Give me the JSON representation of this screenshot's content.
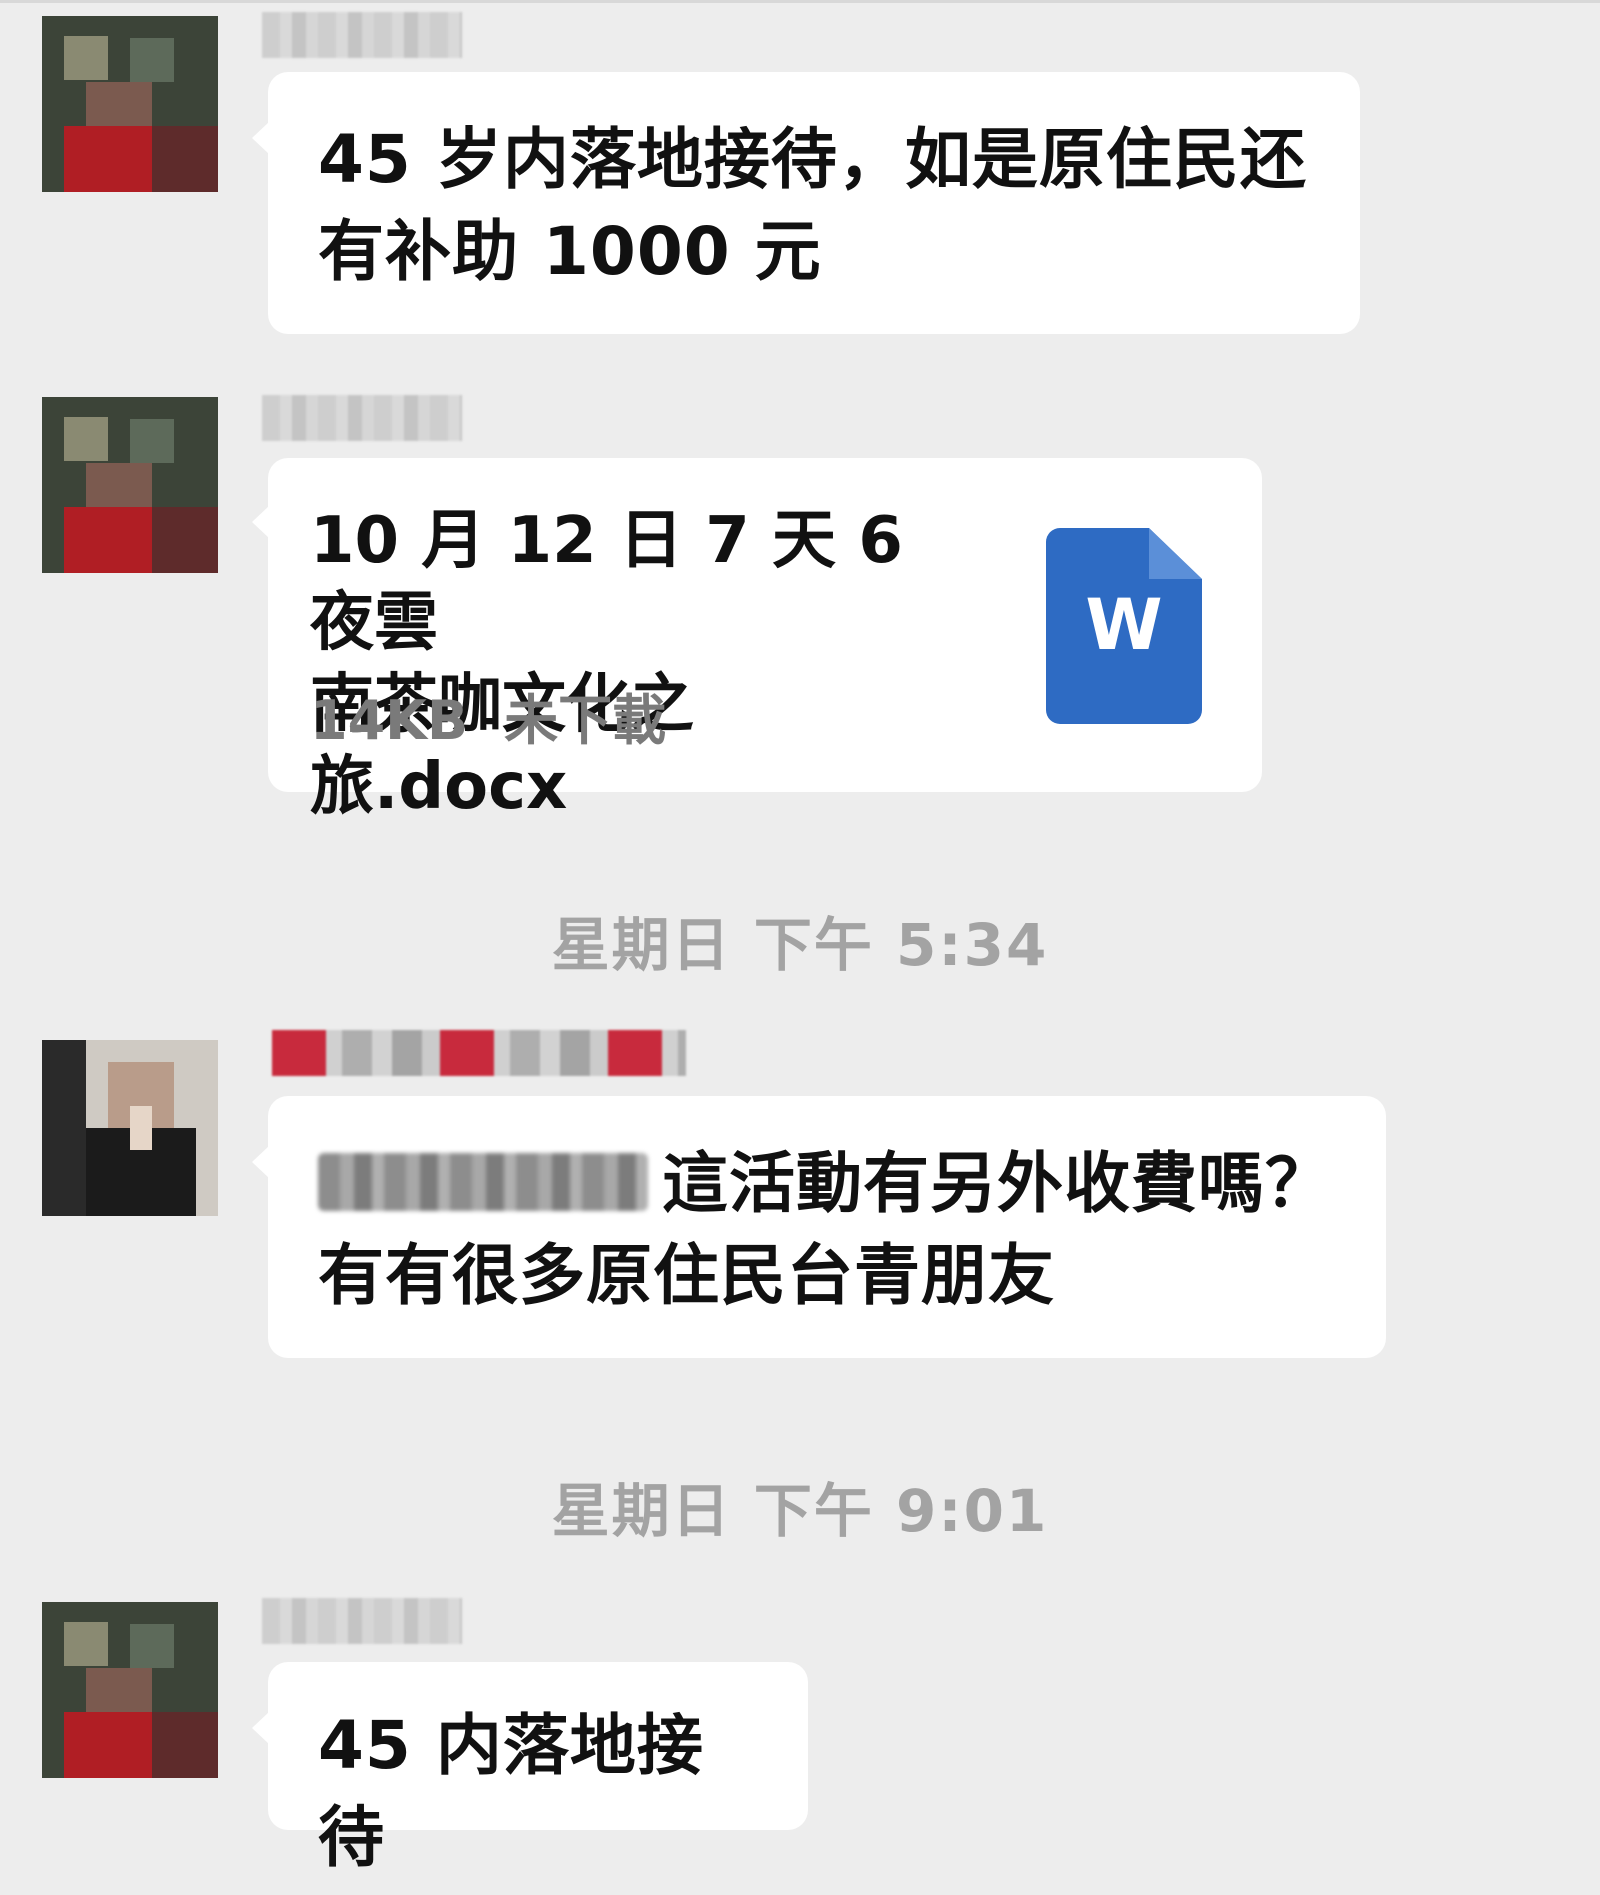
{
  "messages": [
    {
      "text": "45 岁内落地接待，如是原住民还\n有补助 1000 元"
    },
    {
      "file": {
        "name": "10 月 12 日 7 天 6 夜雲\n南茶咖文化之旅.docx",
        "size": "14KB",
        "status": "未下載",
        "icon_letter": "W",
        "icon": "word-document-icon"
      }
    },
    {
      "text": "這活動有另外收費嗎？\n有有很多原住民台青朋友"
    },
    {
      "text": "45 内落地接待"
    }
  ],
  "timestamps": [
    "星期日 下午 5:34",
    "星期日 下午 9:01"
  ],
  "colors": {
    "background": "#ededed",
    "bubble": "#ffffff",
    "word_blue": "#2e6bc3",
    "timestamp": "#a3a3a3"
  }
}
